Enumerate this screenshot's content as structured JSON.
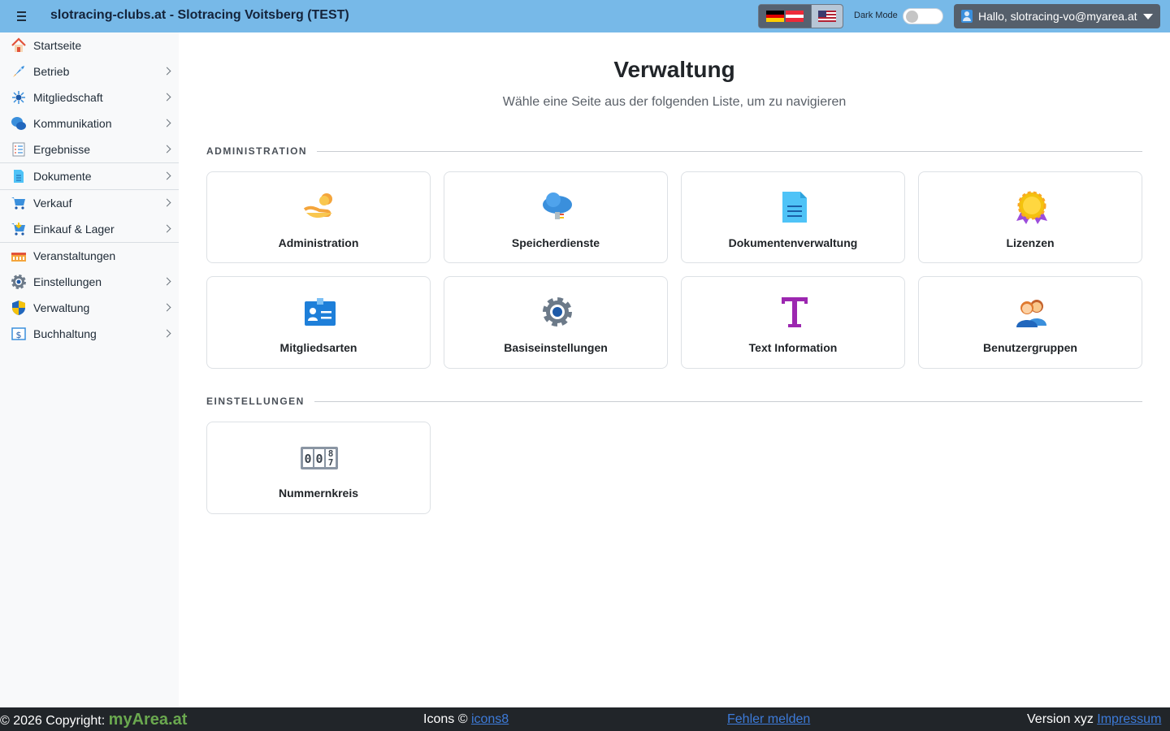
{
  "header": {
    "title": "slotracing-clubs.at - Slotracing Voitsberg (TEST)",
    "dark_mode_label": "Dark Mode",
    "user_greeting": "Hallo, slotracing-vo@myarea.at"
  },
  "sidebar": {
    "items": [
      {
        "label": "Startseite",
        "icon": "house-icon"
      },
      {
        "label": "Betrieb",
        "icon": "rocket-icon"
      },
      {
        "label": "Mitgliedschaft",
        "icon": "network-icon"
      },
      {
        "label": "Kommunikation",
        "icon": "chat-icon"
      },
      {
        "label": "Ergebnisse",
        "icon": "checklist-icon"
      },
      {
        "label": "Dokumente",
        "icon": "document-icon"
      },
      {
        "label": "Verkauf",
        "icon": "cart-icon"
      },
      {
        "label": "Einkauf & Lager",
        "icon": "basket-icon"
      },
      {
        "label": "Veranstaltungen",
        "icon": "stadium-icon"
      },
      {
        "label": "Einstellungen",
        "icon": "gear-icon"
      },
      {
        "label": "Verwaltung",
        "icon": "shield-icon"
      },
      {
        "label": "Buchhaltung",
        "icon": "invoice-icon"
      }
    ]
  },
  "main": {
    "title": "Verwaltung",
    "subtitle": "Wähle eine Seite aus der folgenden Liste, um zu navigieren",
    "sections": [
      {
        "heading": "ADMINISTRATION",
        "cards": [
          {
            "label": "Administration",
            "icon": "hand-coins-icon"
          },
          {
            "label": "Speicherdienste",
            "icon": "cloud-plug-icon"
          },
          {
            "label": "Dokumentenverwaltung",
            "icon": "document-icon"
          },
          {
            "label": "Lizenzen",
            "icon": "award-icon"
          },
          {
            "label": "Mitgliedsarten",
            "icon": "id-card-icon"
          },
          {
            "label": "Basiseinstellungen",
            "icon": "gear-icon"
          },
          {
            "label": "Text Information",
            "icon": "letter-t-icon"
          },
          {
            "label": "Benutzergruppen",
            "icon": "users-icon"
          }
        ]
      },
      {
        "heading": "EINSTELLUNGEN",
        "cards": [
          {
            "label": "Nummernkreis",
            "icon": "counter-icon",
            "counter_digits": [
              "0",
              "0",
              "8",
              "7"
            ]
          }
        ]
      }
    ]
  },
  "footer": {
    "copyright": "© 2026 Copyright:",
    "brand_my": "my",
    "brand_area": "Area.at",
    "icons_text": "Icons ©",
    "icons_link": "icons8",
    "report_link": "Fehler melden",
    "version_text": "Version xyz",
    "impressum_link": "Impressum"
  },
  "colors": {
    "topbar": "#77b9e8",
    "sidebar": "#f8f9fa",
    "footer": "#212529",
    "link": "#3d7bd9",
    "brand": "#6aa84f"
  }
}
